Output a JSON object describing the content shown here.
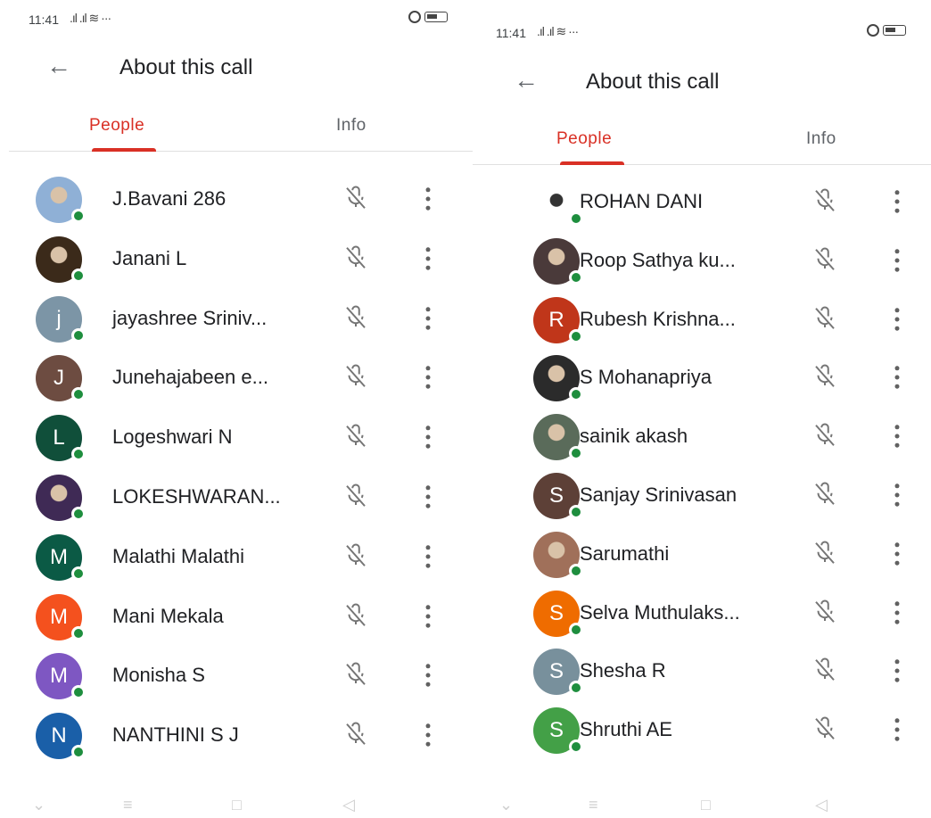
{
  "screens": [
    {
      "status": {
        "time": "11:41",
        "signal": ".ıl .ıl ≋ ···"
      },
      "header": {
        "title": "About this call"
      },
      "tabs": {
        "people": "People",
        "info": "Info"
      },
      "participants": [
        {
          "name": "J.Bavani 286",
          "initial": "",
          "color": "#8fb0d6",
          "photo": true
        },
        {
          "name": "Janani L",
          "initial": "",
          "color": "#3b2a1a",
          "photo": true
        },
        {
          "name": "jayashree Sriniv...",
          "initial": "j",
          "color": "#7c95a6"
        },
        {
          "name": "Junehajabeen e...",
          "initial": "J",
          "color": "#6d4c41"
        },
        {
          "name": "Logeshwari N",
          "initial": "L",
          "color": "#104f3a"
        },
        {
          "name": "LOKESHWARAN...",
          "initial": "",
          "color": "#3f2a55",
          "photo": true
        },
        {
          "name": "Malathi Malathi",
          "initial": "M",
          "color": "#0b5a45"
        },
        {
          "name": "Mani Mekala",
          "initial": "M",
          "color": "#f4511e"
        },
        {
          "name": "Monisha S",
          "initial": "M",
          "color": "#7e57c2"
        },
        {
          "name": "NANTHINI S J",
          "initial": "N",
          "color": "#1a5fa8"
        }
      ]
    },
    {
      "status": {
        "time": "11:41",
        "signal": ".ıl .ıl ≋ ···"
      },
      "header": {
        "title": "About this call"
      },
      "tabs": {
        "people": "People",
        "info": "Info"
      },
      "participants": [
        {
          "name": "ROHAN DANI",
          "initial": "",
          "color": "#ffffff",
          "photo": true
        },
        {
          "name": "Roop Sathya ku...",
          "initial": "",
          "color": "#4a3a3a",
          "photo": true
        },
        {
          "name": "Rubesh Krishna...",
          "initial": "R",
          "color": "#c0361a"
        },
        {
          "name": "S Mohanapriya",
          "initial": "",
          "color": "#2b2b2b",
          "photo": true
        },
        {
          "name": "sainik akash",
          "initial": "",
          "color": "#5a6b5a",
          "photo": true
        },
        {
          "name": "Sanjay Srinivasan",
          "initial": "S",
          "color": "#5d4037"
        },
        {
          "name": "Sarumathi",
          "initial": "",
          "color": "#a0705a",
          "photo": true
        },
        {
          "name": "Selva Muthulaks...",
          "initial": "S",
          "color": "#ef6c00"
        },
        {
          "name": "Shesha R",
          "initial": "S",
          "color": "#78909c"
        },
        {
          "name": "Shruthi AE",
          "initial": "S",
          "color": "#43a047"
        }
      ]
    }
  ],
  "icons": {
    "back": "arrow-back-icon",
    "mic": "mic-off-icon",
    "more": "more-vert-icon"
  }
}
